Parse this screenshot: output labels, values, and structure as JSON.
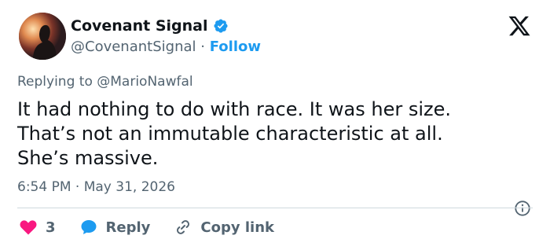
{
  "user": {
    "display_name": "Covenant Signal",
    "handle": "@CovenantSignal",
    "separator": "·",
    "follow_label": "Follow"
  },
  "reply": {
    "prefix": "Replying to",
    "mention": "@MarioNawfal"
  },
  "tweet": {
    "text": "It had nothing to do with race.  It was her size.\nThat’s not an immutable characteristic at all.\nShe’s massive."
  },
  "meta": {
    "time": "6:54 PM",
    "separator": "·",
    "date": "May 31, 2026"
  },
  "actions": {
    "likes": "3",
    "reply_label": "Reply",
    "copy_label": "Copy link"
  },
  "icons": {
    "verified": "verified-badge-icon",
    "logo": "x-logo-icon",
    "info": "info-icon",
    "heart": "heart-icon",
    "reply": "reply-bubble-icon",
    "link": "link-icon"
  },
  "colors": {
    "accent": "#1d9bf0",
    "like": "#f91880",
    "reply": "#1d9bf0",
    "muted": "#536471",
    "text": "#0f1419"
  }
}
